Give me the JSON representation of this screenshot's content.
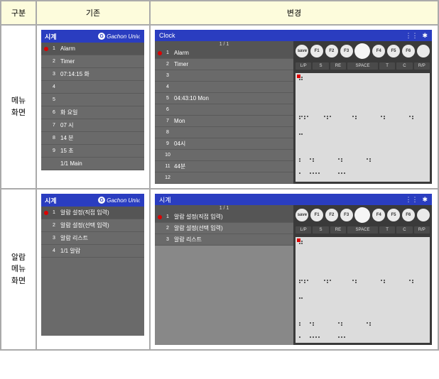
{
  "header": {
    "col1": "구분",
    "col2": "기존",
    "col3": "변경"
  },
  "rows": [
    {
      "label": "메뉴\n화면"
    },
    {
      "label": "알람\n메뉴\n화면"
    }
  ],
  "before1": {
    "title": "시계",
    "brand": "Gachon Univ.",
    "items": [
      {
        "n": "1",
        "t": "Alarm",
        "sel": true
      },
      {
        "n": "2",
        "t": "Timer"
      },
      {
        "n": "3",
        "t": "07:14:15 화"
      },
      {
        "n": "4",
        "t": ""
      },
      {
        "n": "5",
        "t": ""
      },
      {
        "n": "6",
        "t": "화 요일"
      },
      {
        "n": "7",
        "t": "07 시"
      },
      {
        "n": "8",
        "t": "14 분"
      },
      {
        "n": "9",
        "t": "15 초"
      },
      {
        "n": "",
        "t": "1/1  Main"
      }
    ]
  },
  "after1": {
    "title": "Clock",
    "pager": "1 / 1",
    "items": [
      {
        "n": "1",
        "t": "Alarm",
        "sel": true
      },
      {
        "n": "2",
        "t": "Timer"
      },
      {
        "n": "3",
        "t": ""
      },
      {
        "n": "4",
        "t": ""
      },
      {
        "n": "5",
        "t": "04:43:10 Mon"
      },
      {
        "n": "6",
        "t": ""
      },
      {
        "n": "7",
        "t": "Mon"
      },
      {
        "n": "8",
        "t": ""
      },
      {
        "n": "9",
        "t": "04시"
      },
      {
        "n": "10",
        "t": ""
      },
      {
        "n": "11",
        "t": "44분"
      },
      {
        "n": "12",
        "t": ""
      }
    ],
    "fkeys_left": "save",
    "fkeys": [
      "F1",
      "F2",
      "F3",
      "",
      "F4",
      "F5",
      "F6"
    ],
    "keys": [
      "L/P",
      "S",
      "RE",
      "SPACE",
      "T",
      "C",
      "R/P"
    ]
  },
  "before2": {
    "title": "시계",
    "brand": "Gachon Univ.",
    "items": [
      {
        "n": "1",
        "t": "알람 설정(직접 입력)",
        "sel": true
      },
      {
        "n": "2",
        "t": "알람 설정(선택 입력)"
      },
      {
        "n": "3",
        "t": "알람 리스트"
      },
      {
        "n": "4",
        "t": "1/1  알람"
      }
    ]
  },
  "after2": {
    "title": "시계",
    "pager": "1 / 1",
    "items": [
      {
        "n": "1",
        "t": "알람 설정(직접 입력)",
        "sel": true
      },
      {
        "n": "2",
        "t": "알람 설정(선택 입력)"
      },
      {
        "n": "3",
        "t": "알람 리스트"
      }
    ],
    "fkeys_left": "save",
    "fkeys": [
      "F1",
      "F2",
      "F3",
      "",
      "F4",
      "F5",
      "F6"
    ],
    "keys": [
      "L/P",
      "S",
      "RE",
      "SPACE",
      "T",
      "C",
      "R/P"
    ]
  },
  "icons": {
    "wifi": "wifi-icon",
    "bt": "bluetooth-icon"
  }
}
